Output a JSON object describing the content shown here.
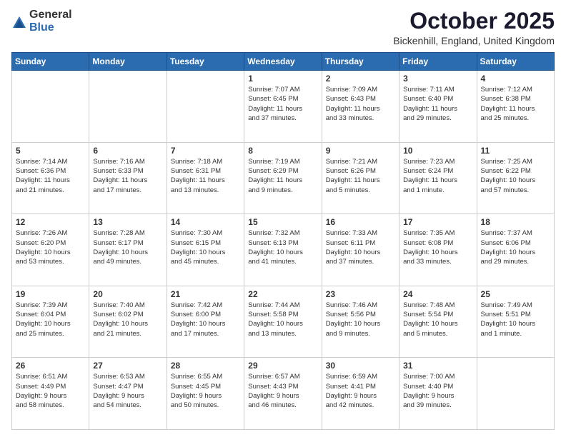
{
  "logo": {
    "general": "General",
    "blue": "Blue"
  },
  "header": {
    "month": "October 2025",
    "location": "Bickenhill, England, United Kingdom"
  },
  "weekdays": [
    "Sunday",
    "Monday",
    "Tuesday",
    "Wednesday",
    "Thursday",
    "Friday",
    "Saturday"
  ],
  "weeks": [
    [
      {
        "day": "",
        "info": ""
      },
      {
        "day": "",
        "info": ""
      },
      {
        "day": "",
        "info": ""
      },
      {
        "day": "1",
        "info": "Sunrise: 7:07 AM\nSunset: 6:45 PM\nDaylight: 11 hours\nand 37 minutes."
      },
      {
        "day": "2",
        "info": "Sunrise: 7:09 AM\nSunset: 6:43 PM\nDaylight: 11 hours\nand 33 minutes."
      },
      {
        "day": "3",
        "info": "Sunrise: 7:11 AM\nSunset: 6:40 PM\nDaylight: 11 hours\nand 29 minutes."
      },
      {
        "day": "4",
        "info": "Sunrise: 7:12 AM\nSunset: 6:38 PM\nDaylight: 11 hours\nand 25 minutes."
      }
    ],
    [
      {
        "day": "5",
        "info": "Sunrise: 7:14 AM\nSunset: 6:36 PM\nDaylight: 11 hours\nand 21 minutes."
      },
      {
        "day": "6",
        "info": "Sunrise: 7:16 AM\nSunset: 6:33 PM\nDaylight: 11 hours\nand 17 minutes."
      },
      {
        "day": "7",
        "info": "Sunrise: 7:18 AM\nSunset: 6:31 PM\nDaylight: 11 hours\nand 13 minutes."
      },
      {
        "day": "8",
        "info": "Sunrise: 7:19 AM\nSunset: 6:29 PM\nDaylight: 11 hours\nand 9 minutes."
      },
      {
        "day": "9",
        "info": "Sunrise: 7:21 AM\nSunset: 6:26 PM\nDaylight: 11 hours\nand 5 minutes."
      },
      {
        "day": "10",
        "info": "Sunrise: 7:23 AM\nSunset: 6:24 PM\nDaylight: 11 hours\nand 1 minute."
      },
      {
        "day": "11",
        "info": "Sunrise: 7:25 AM\nSunset: 6:22 PM\nDaylight: 10 hours\nand 57 minutes."
      }
    ],
    [
      {
        "day": "12",
        "info": "Sunrise: 7:26 AM\nSunset: 6:20 PM\nDaylight: 10 hours\nand 53 minutes."
      },
      {
        "day": "13",
        "info": "Sunrise: 7:28 AM\nSunset: 6:17 PM\nDaylight: 10 hours\nand 49 minutes."
      },
      {
        "day": "14",
        "info": "Sunrise: 7:30 AM\nSunset: 6:15 PM\nDaylight: 10 hours\nand 45 minutes."
      },
      {
        "day": "15",
        "info": "Sunrise: 7:32 AM\nSunset: 6:13 PM\nDaylight: 10 hours\nand 41 minutes."
      },
      {
        "day": "16",
        "info": "Sunrise: 7:33 AM\nSunset: 6:11 PM\nDaylight: 10 hours\nand 37 minutes."
      },
      {
        "day": "17",
        "info": "Sunrise: 7:35 AM\nSunset: 6:08 PM\nDaylight: 10 hours\nand 33 minutes."
      },
      {
        "day": "18",
        "info": "Sunrise: 7:37 AM\nSunset: 6:06 PM\nDaylight: 10 hours\nand 29 minutes."
      }
    ],
    [
      {
        "day": "19",
        "info": "Sunrise: 7:39 AM\nSunset: 6:04 PM\nDaylight: 10 hours\nand 25 minutes."
      },
      {
        "day": "20",
        "info": "Sunrise: 7:40 AM\nSunset: 6:02 PM\nDaylight: 10 hours\nand 21 minutes."
      },
      {
        "day": "21",
        "info": "Sunrise: 7:42 AM\nSunset: 6:00 PM\nDaylight: 10 hours\nand 17 minutes."
      },
      {
        "day": "22",
        "info": "Sunrise: 7:44 AM\nSunset: 5:58 PM\nDaylight: 10 hours\nand 13 minutes."
      },
      {
        "day": "23",
        "info": "Sunrise: 7:46 AM\nSunset: 5:56 PM\nDaylight: 10 hours\nand 9 minutes."
      },
      {
        "day": "24",
        "info": "Sunrise: 7:48 AM\nSunset: 5:54 PM\nDaylight: 10 hours\nand 5 minutes."
      },
      {
        "day": "25",
        "info": "Sunrise: 7:49 AM\nSunset: 5:51 PM\nDaylight: 10 hours\nand 1 minute."
      }
    ],
    [
      {
        "day": "26",
        "info": "Sunrise: 6:51 AM\nSunset: 4:49 PM\nDaylight: 9 hours\nand 58 minutes."
      },
      {
        "day": "27",
        "info": "Sunrise: 6:53 AM\nSunset: 4:47 PM\nDaylight: 9 hours\nand 54 minutes."
      },
      {
        "day": "28",
        "info": "Sunrise: 6:55 AM\nSunset: 4:45 PM\nDaylight: 9 hours\nand 50 minutes."
      },
      {
        "day": "29",
        "info": "Sunrise: 6:57 AM\nSunset: 4:43 PM\nDaylight: 9 hours\nand 46 minutes."
      },
      {
        "day": "30",
        "info": "Sunrise: 6:59 AM\nSunset: 4:41 PM\nDaylight: 9 hours\nand 42 minutes."
      },
      {
        "day": "31",
        "info": "Sunrise: 7:00 AM\nSunset: 4:40 PM\nDaylight: 9 hours\nand 39 minutes."
      },
      {
        "day": "",
        "info": ""
      }
    ]
  ]
}
